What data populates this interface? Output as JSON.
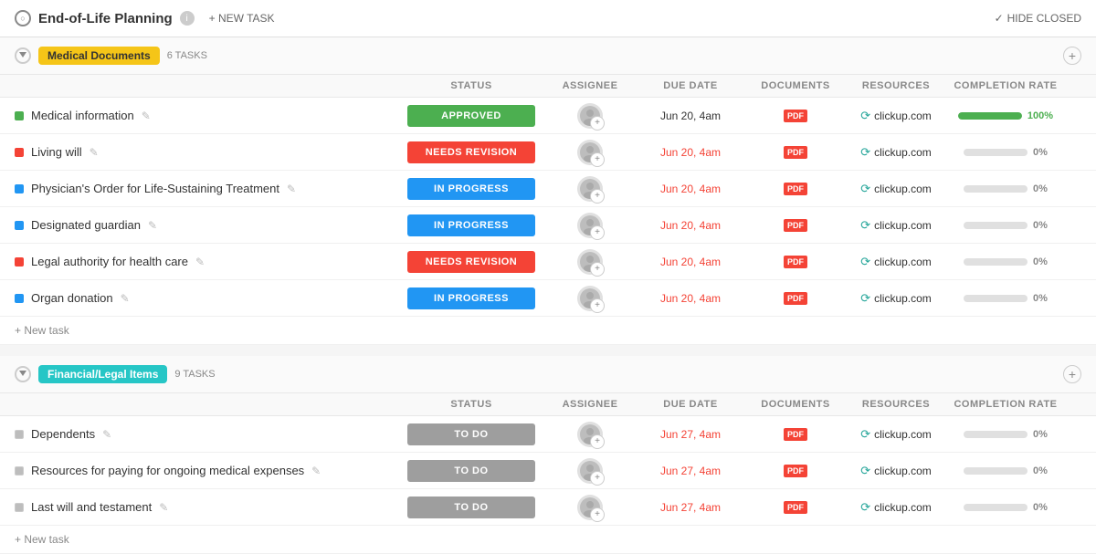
{
  "header": {
    "title": "End-of-Life Planning",
    "new_task_label": "+ NEW TASK",
    "hide_closed_label": "HIDE CLOSED"
  },
  "groups": [
    {
      "id": "medical-documents",
      "name": "Medical Documents",
      "badge_color": "yellow",
      "task_count": "6 TASKS",
      "columns": [
        "STATUS",
        "ASSIGNEE",
        "DUE DATE",
        "DOCUMENTS",
        "RESOURCES",
        "COMPLETION RATE"
      ],
      "tasks": [
        {
          "name": "Medical information",
          "dot": "green",
          "status": "APPROVED",
          "status_type": "approved",
          "due_date": "Jun 20, 4am",
          "due_overdue": false,
          "documents": "PDF",
          "resource": "clickup.com",
          "completion": 100,
          "pct_label": "100%"
        },
        {
          "name": "Living will",
          "dot": "red",
          "status": "NEEDS REVISION",
          "status_type": "needs-revision",
          "due_date": "Jun 20, 4am",
          "due_overdue": true,
          "documents": "PDF",
          "resource": "clickup.com",
          "completion": 0,
          "pct_label": "0%"
        },
        {
          "name": "Physician's Order for Life-Sustaining Treatment",
          "dot": "blue",
          "status": "IN PROGRESS",
          "status_type": "in-progress",
          "due_date": "Jun 20, 4am",
          "due_overdue": true,
          "documents": "PDF",
          "resource": "clickup.com",
          "completion": 0,
          "pct_label": "0%"
        },
        {
          "name": "Designated guardian",
          "dot": "blue",
          "status": "IN PROGRESS",
          "status_type": "in-progress",
          "due_date": "Jun 20, 4am",
          "due_overdue": true,
          "documents": "PDF",
          "resource": "clickup.com",
          "completion": 0,
          "pct_label": "0%"
        },
        {
          "name": "Legal authority for health care",
          "dot": "red",
          "status": "NEEDS REVISION",
          "status_type": "needs-revision",
          "due_date": "Jun 20, 4am",
          "due_overdue": true,
          "documents": "PDF",
          "resource": "clickup.com",
          "completion": 0,
          "pct_label": "0%"
        },
        {
          "name": "Organ donation",
          "dot": "blue",
          "status": "IN PROGRESS",
          "status_type": "in-progress",
          "due_date": "Jun 20, 4am",
          "due_overdue": true,
          "documents": "PDF",
          "resource": "clickup.com",
          "completion": 0,
          "pct_label": "0%"
        }
      ],
      "new_task_label": "+ New task"
    },
    {
      "id": "financial-legal",
      "name": "Financial/Legal Items",
      "badge_color": "teal",
      "task_count": "9 TASKS",
      "columns": [
        "STATUS",
        "ASSIGNEE",
        "DUE DATE",
        "DOCUMENTS",
        "RESOURCES",
        "COMPLETION RATE"
      ],
      "tasks": [
        {
          "name": "Dependents",
          "dot": "gray",
          "status": "TO DO",
          "status_type": "todo",
          "due_date": "Jun 27, 4am",
          "due_overdue": true,
          "documents": "PDF",
          "resource": "clickup.com",
          "completion": 0,
          "pct_label": "0%"
        },
        {
          "name": "Resources for paying for ongoing medical expenses",
          "dot": "gray",
          "status": "TO DO",
          "status_type": "todo",
          "due_date": "Jun 27, 4am",
          "due_overdue": true,
          "documents": "PDF",
          "resource": "clickup.com",
          "completion": 0,
          "pct_label": "0%"
        },
        {
          "name": "Last will and testament",
          "dot": "gray",
          "status": "TO DO",
          "status_type": "todo",
          "due_date": "Jun 27, 4am",
          "due_overdue": true,
          "documents": "PDF",
          "resource": "clickup.com",
          "completion": 0,
          "pct_label": "0%"
        }
      ],
      "new_task_label": "+ New task"
    }
  ]
}
